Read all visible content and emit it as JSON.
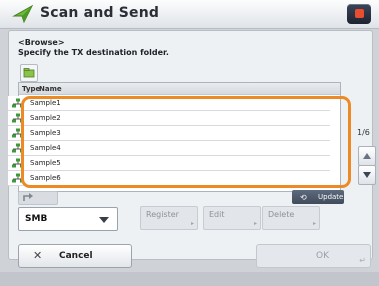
{
  "header": {
    "title": "Scan and Send"
  },
  "instructions": {
    "line1": "<Browse>",
    "line2": "Specify the TX destination folder."
  },
  "list": {
    "col_type": "Type",
    "col_name": "Name",
    "rows": [
      {
        "name": "Sample1",
        "icon": "network-folder-icon"
      },
      {
        "name": "Sample2",
        "icon": "network-folder-icon"
      },
      {
        "name": "Sample3",
        "icon": "network-folder-icon"
      },
      {
        "name": "Sample4",
        "icon": "network-folder-icon"
      },
      {
        "name": "Sample5",
        "icon": "network-folder-icon"
      },
      {
        "name": "Sample6",
        "icon": "network-folder-icon"
      }
    ],
    "page_indicator": "1/6"
  },
  "buttons": {
    "update": "Update",
    "register": "Register",
    "edit": "Edit",
    "delete": "Delete",
    "cancel": "Cancel",
    "ok": "OK"
  },
  "protocol": {
    "value": "SMB"
  },
  "colors": {
    "highlight": "#ee8a25",
    "accent": "#3e4756"
  }
}
